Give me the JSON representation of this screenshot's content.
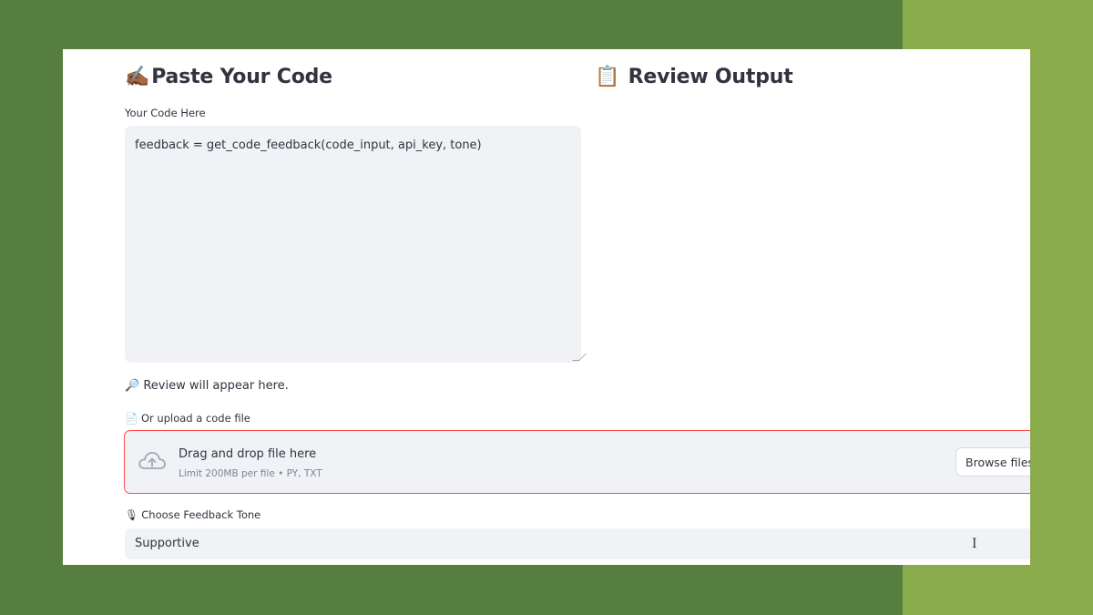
{
  "input_column": {
    "heading_emoji": "✍🏾",
    "heading_text": "Paste Your Code",
    "code_label": "Your Code Here",
    "code_value": "feedback = get_code_feedback(code_input, api_key, tone)"
  },
  "output_column": {
    "heading_emoji": "📋",
    "heading_text": "Review Output"
  },
  "review_placeholder": "🔎 Review will appear here.",
  "upload": {
    "label": "📄 Or upload a code file",
    "dropzone_title": "Drag and drop file here",
    "dropzone_limit": "Limit 200MB per file • PY, TXT",
    "browse_label": "Browse files",
    "icon": "cloud-upload-icon"
  },
  "tone": {
    "label": "🎙 Choose Feedback Tone",
    "selected": "Supportive"
  },
  "colors": {
    "background_left": "#567f3f",
    "background_right": "#8aab4c",
    "dropzone_border": "#ff4b4b",
    "input_bg": "#f0f2f6"
  }
}
